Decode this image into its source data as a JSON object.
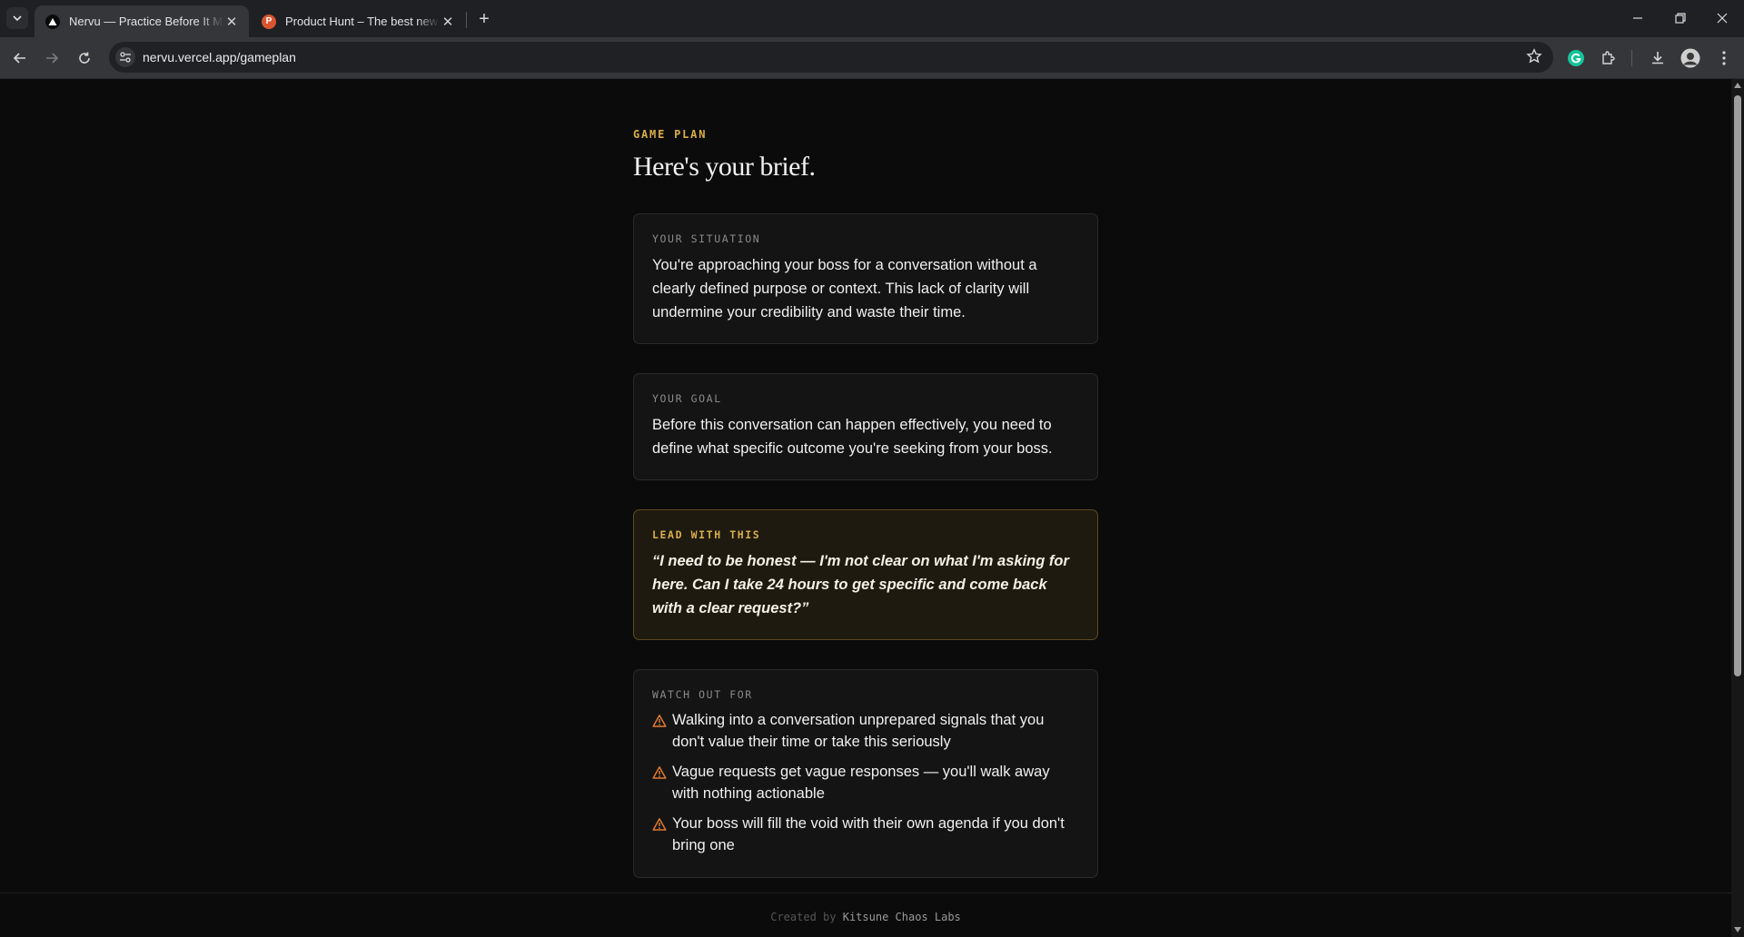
{
  "browser": {
    "tabs": [
      {
        "title": "Nervu — Practice Before It Matters",
        "favicon": "triangle-logo-icon",
        "active": true
      },
      {
        "title": "Product Hunt – The best new products in tech.",
        "favicon": "product-hunt-p-icon",
        "favicon_letter": "P",
        "active": false
      }
    ],
    "url": "nervu.vercel.app/gameplan"
  },
  "page": {
    "eyebrow": "GAME PLAN",
    "headline": "Here's your brief.",
    "situation": {
      "label": "YOUR SITUATION",
      "text": "You're approaching your boss for a conversation without a clearly defined purpose or context. This lack of clarity will undermine your credibility and waste their time."
    },
    "goal": {
      "label": "YOUR GOAL",
      "text": "Before this conversation can happen effectively, you need to define what specific outcome you're seeking from your boss."
    },
    "lead": {
      "label": "LEAD WITH THIS",
      "text": "“I need to be honest — I'm not clear on what I'm asking for here. Can I take 24 hours to get specific and come back with a clear request?”"
    },
    "watch_out": {
      "label": "WATCH OUT FOR",
      "items": [
        "Walking into a conversation unprepared signals that you don't value their time or take this seriously",
        "Vague requests get vague responses — you'll walk away with nothing actionable",
        "Your boss will fill the void with their own agenda if you don't bring one"
      ]
    },
    "footer": {
      "prefix": "Created by",
      "brand": "Kitsune Chaos Labs"
    }
  },
  "colors": {
    "accent_gold": "#d9ad4a",
    "warning_orange": "#e07a2e",
    "background": "#0b0b0b",
    "card": "#141414"
  }
}
